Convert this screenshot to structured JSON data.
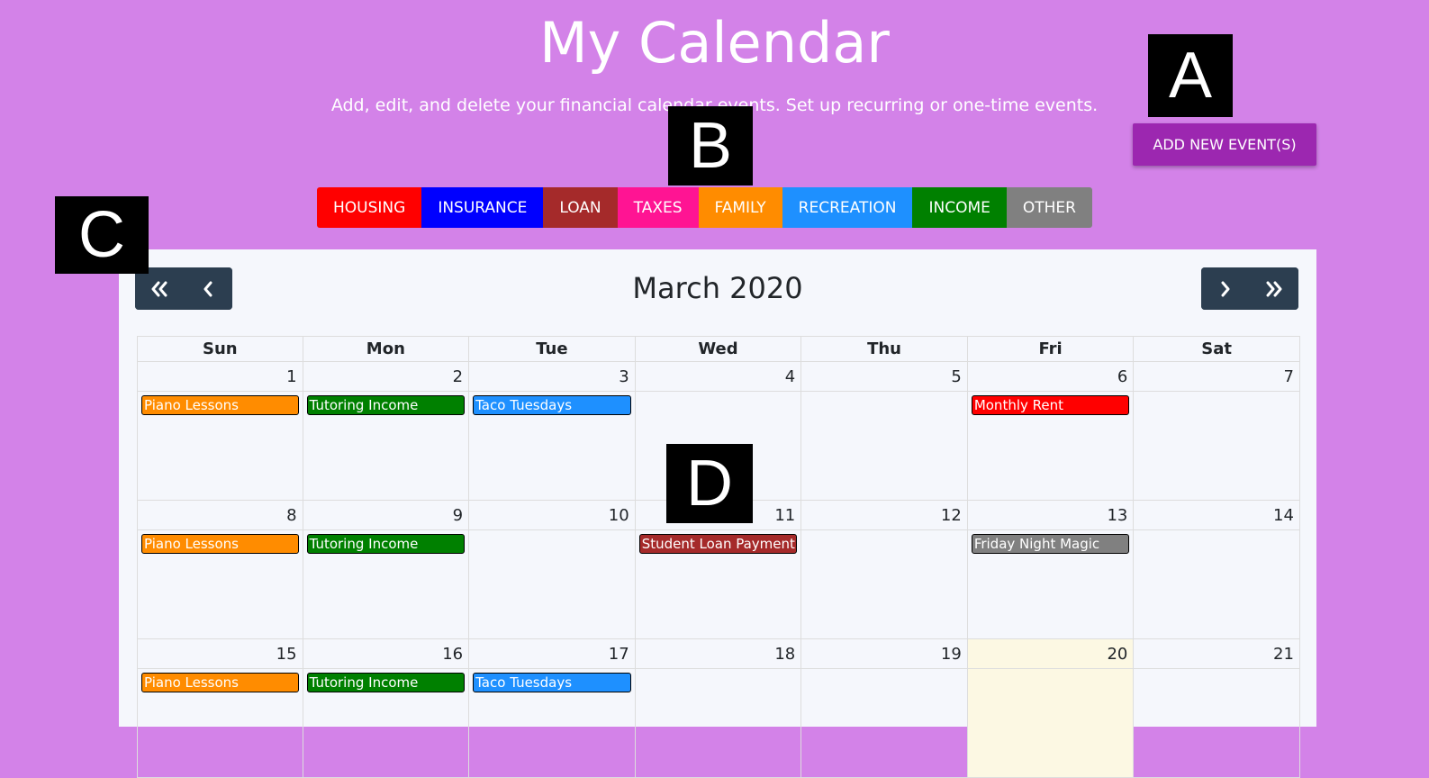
{
  "header": {
    "title": "My Calendar",
    "subtitle": "Add, edit, and delete your financial calendar events. Set up recurring or one-time events.",
    "add_button": "ADD NEW EVENT(S)"
  },
  "markers": {
    "a": "A",
    "b": "B",
    "c": "C",
    "d": "D"
  },
  "categories": [
    {
      "label": "HOUSING",
      "color": "#ff0000"
    },
    {
      "label": "INSURANCE",
      "color": "#0000ff"
    },
    {
      "label": "LOAN",
      "color": "#a52a2a"
    },
    {
      "label": "TAXES",
      "color": "#ff1493"
    },
    {
      "label": "FAMILY",
      "color": "#ff8c00"
    },
    {
      "label": "RECREATION",
      "color": "#1e90ff"
    },
    {
      "label": "INCOME",
      "color": "#008000"
    },
    {
      "label": "OTHER",
      "color": "#808080"
    }
  ],
  "calendar": {
    "month_title": "March 2020",
    "nav": {
      "prev_year_icon": "double-chevron-left-icon",
      "prev_month_icon": "chevron-left-icon",
      "next_month_icon": "chevron-right-icon",
      "next_year_icon": "double-chevron-right-icon"
    },
    "weekdays": [
      "Sun",
      "Mon",
      "Tue",
      "Wed",
      "Thu",
      "Fri",
      "Sat"
    ],
    "today": "20",
    "weeks": [
      [
        {
          "day": "1",
          "event": {
            "title": "Piano Lessons",
            "color": "#ff8c00"
          }
        },
        {
          "day": "2",
          "event": {
            "title": "Tutoring Income",
            "color": "#008000"
          }
        },
        {
          "day": "3",
          "event": {
            "title": "Taco Tuesdays",
            "color": "#1e90ff"
          }
        },
        {
          "day": "4"
        },
        {
          "day": "5"
        },
        {
          "day": "6",
          "event": {
            "title": "Monthly Rent",
            "color": "#ff0000"
          }
        },
        {
          "day": "7"
        }
      ],
      [
        {
          "day": "8",
          "event": {
            "title": "Piano Lessons",
            "color": "#ff8c00"
          }
        },
        {
          "day": "9",
          "event": {
            "title": "Tutoring Income",
            "color": "#008000"
          }
        },
        {
          "day": "10"
        },
        {
          "day": "11",
          "event": {
            "title": "Student Loan Payment",
            "color": "#a52a2a"
          }
        },
        {
          "day": "12"
        },
        {
          "day": "13",
          "event": {
            "title": "Friday Night Magic",
            "color": "#808080"
          }
        },
        {
          "day": "14"
        }
      ],
      [
        {
          "day": "15",
          "event": {
            "title": "Piano Lessons",
            "color": "#ff8c00"
          }
        },
        {
          "day": "16",
          "event": {
            "title": "Tutoring Income",
            "color": "#008000"
          }
        },
        {
          "day": "17",
          "event": {
            "title": "Taco Tuesdays",
            "color": "#1e90ff"
          }
        },
        {
          "day": "18"
        },
        {
          "day": "19"
        },
        {
          "day": "20"
        },
        {
          "day": "21"
        }
      ]
    ]
  }
}
